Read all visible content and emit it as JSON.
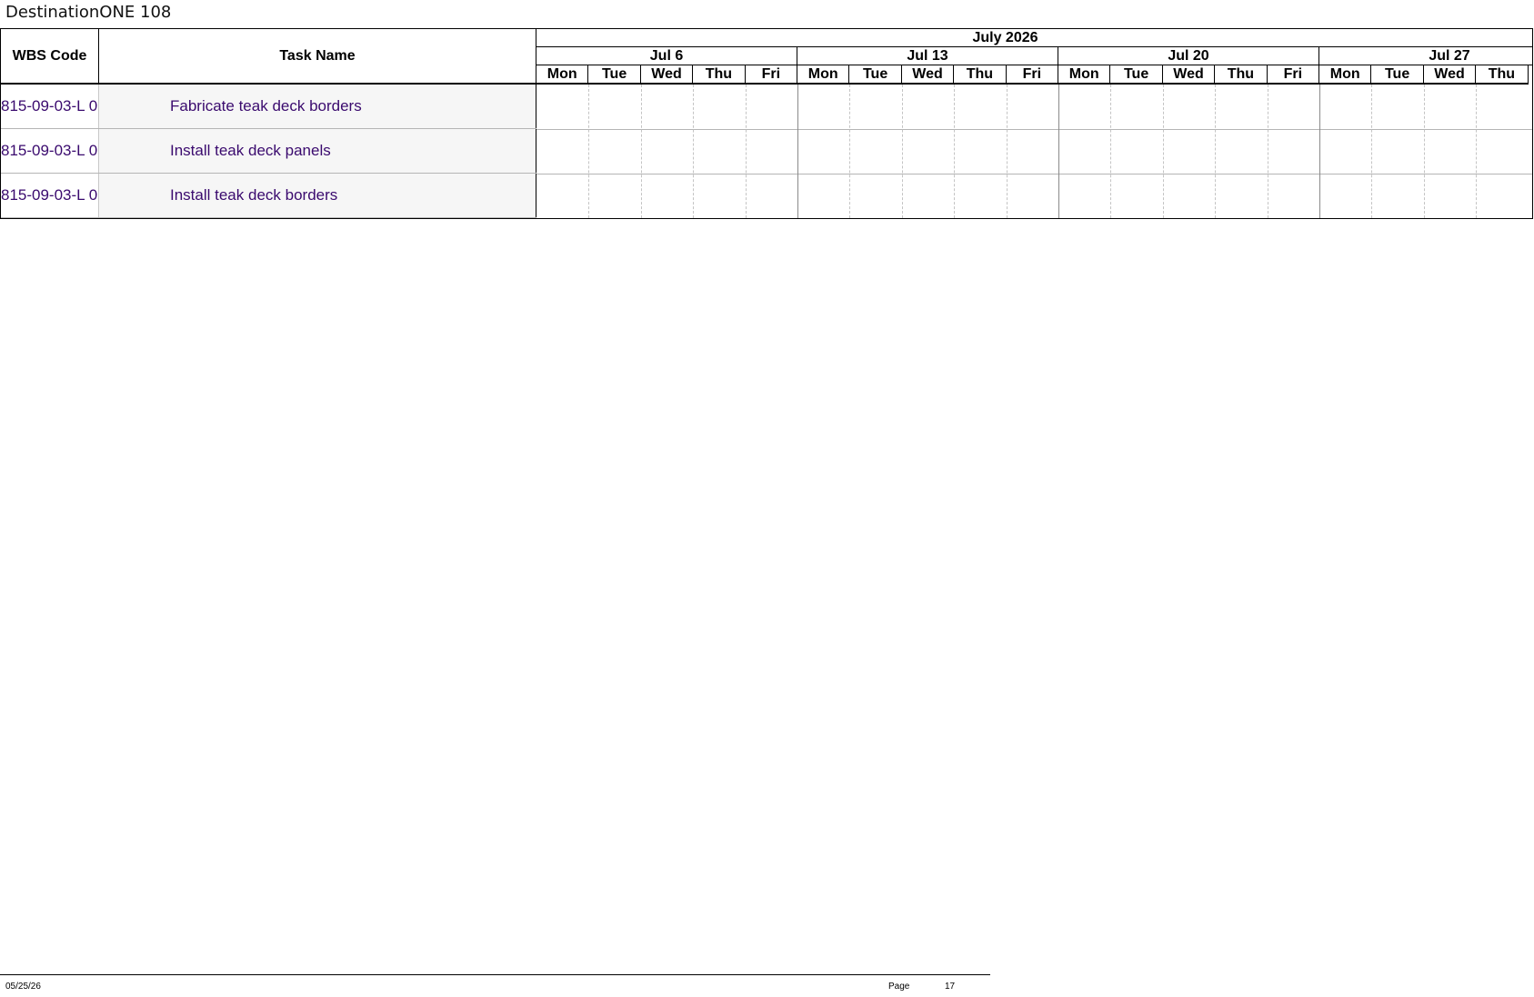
{
  "document": {
    "title": "DestinationONE 108"
  },
  "table": {
    "headers": {
      "wbs": "WBS Code",
      "task": "Task Name"
    },
    "rows": [
      {
        "wbs": "815-09-03-L 0",
        "task": "Fabricate teak deck borders"
      },
      {
        "wbs": "815-09-03-L 0",
        "task": "Install teak deck panels"
      },
      {
        "wbs": "815-09-03-L 0",
        "task": "Install teak deck borders"
      }
    ]
  },
  "timeline": {
    "month": "July 2026",
    "weeks": [
      {
        "label": "Jul 6",
        "days": [
          "Mon",
          "Tue",
          "Wed",
          "Thu",
          "Fri"
        ]
      },
      {
        "label": "Jul 13",
        "days": [
          "Mon",
          "Tue",
          "Wed",
          "Thu",
          "Fri"
        ]
      },
      {
        "label": "Jul 20",
        "days": [
          "Mon",
          "Tue",
          "Wed",
          "Thu",
          "Fri"
        ]
      },
      {
        "label": "Jul 27",
        "days": [
          "Mon",
          "Tue",
          "Wed",
          "Thu"
        ]
      }
    ]
  },
  "footer": {
    "date": "05/25/26",
    "page_label": "Page",
    "page_number": "17"
  },
  "colors": {
    "task_text": "#3a0a6e",
    "task_cell_bg": "#f6f6f6"
  }
}
